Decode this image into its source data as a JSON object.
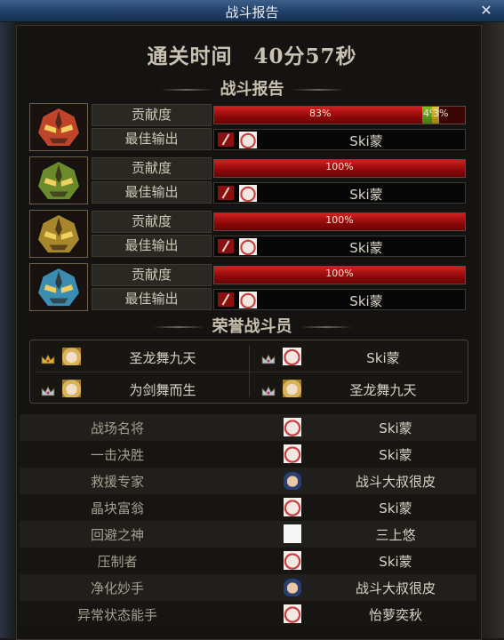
{
  "window": {
    "title": "战斗报告",
    "close_glyph": "✕"
  },
  "clear_time": "通关时间　40分57秒",
  "sections": {
    "battle_report": "战斗报告",
    "honor": "荣誉战斗员"
  },
  "labels": {
    "contribution": "贡献度",
    "best_output": "最佳输出"
  },
  "bosses": [
    {
      "icon": "fire-demon-mask-icon",
      "color": "#c0442a",
      "contribution": [
        {
          "value": 83,
          "text": "83%",
          "color": "red"
        },
        {
          "value": 4,
          "text": "4%",
          "color": "green"
        },
        {
          "value": 3,
          "text": "3%",
          "color": "yellow"
        }
      ],
      "best_player": "Ski蒙",
      "avatar": "avatar-girl"
    },
    {
      "icon": "green-demon-mask-icon",
      "color": "#6a8a2c",
      "contribution": [
        {
          "value": 100,
          "text": "100%",
          "color": "red"
        }
      ],
      "best_player": "Ski蒙",
      "avatar": "avatar-girl"
    },
    {
      "icon": "gold-demon-mask-icon",
      "color": "#a8862c",
      "contribution": [
        {
          "value": 100,
          "text": "100%",
          "color": "red"
        }
      ],
      "best_player": "Ski蒙",
      "avatar": "avatar-girl"
    },
    {
      "icon": "blue-demon-mask-icon",
      "color": "#3a8cb0",
      "contribution": [
        {
          "value": 100,
          "text": "100%",
          "color": "red"
        }
      ],
      "best_player": "Ski蒙",
      "avatar": "avatar-girl"
    }
  ],
  "honor_members": [
    {
      "name": "圣龙舞九天",
      "avatar": "avatar-blonde",
      "crown": "gold-crown-icon"
    },
    {
      "name": "Ski蒙",
      "avatar": "avatar-girl",
      "crown": "silver-crown-icon"
    },
    {
      "name": "为剑舞而生",
      "avatar": "avatar-blonde",
      "crown": "silver-crown-icon"
    },
    {
      "name": "圣龙舞九天",
      "avatar": "avatar-blonde",
      "crown": "silver-crown-icon"
    }
  ],
  "awards": [
    {
      "title": "战场名将",
      "player": "Ski蒙",
      "avatar": "avatar-girl"
    },
    {
      "title": "一击决胜",
      "player": "Ski蒙",
      "avatar": "avatar-girl"
    },
    {
      "title": "救援专家",
      "player": "战斗大叔很皮",
      "avatar": "avatar-boy"
    },
    {
      "title": "晶块富翁",
      "player": "Ski蒙",
      "avatar": "avatar-girl"
    },
    {
      "title": "回避之神",
      "player": "三上悠",
      "avatar": "avatar-white"
    },
    {
      "title": "压制者",
      "player": "Ski蒙",
      "avatar": "avatar-girl"
    },
    {
      "title": "净化妙手",
      "player": "战斗大叔很皮",
      "avatar": "avatar-boy"
    },
    {
      "title": "异常状态能手",
      "player": "怡萝奕秋",
      "avatar": "avatar-girl"
    }
  ]
}
